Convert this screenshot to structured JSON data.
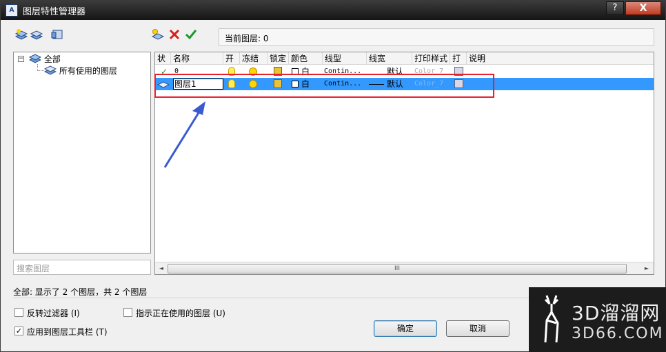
{
  "window": {
    "title": "图层特性管理器",
    "icon_text": "A",
    "help_label": "?",
    "close_label": "X"
  },
  "toolbar": {
    "left_icons": [
      "new-filter-icon",
      "group-filter-icon",
      "state-manager-icon"
    ],
    "right_icons": [
      "new-layer-icon",
      "delete-layer-icon",
      "set-current-icon"
    ]
  },
  "current_layer": {
    "label": "当前图层: 0"
  },
  "tree": {
    "root_label": "全部",
    "toggle": "−",
    "child_label": "所有使用的图层"
  },
  "search": {
    "placeholder": "搜索图层"
  },
  "table": {
    "headers": [
      "状",
      "名称",
      "开",
      "冻结",
      "锁定",
      "颜色",
      "线型",
      "线宽",
      "打印样式",
      "打",
      "说明"
    ],
    "rows": [
      {
        "status": "✓",
        "name": "0",
        "color_name": "白",
        "linetype": "Contin...",
        "lineweight": "默认",
        "plot_style": "Color_7"
      },
      {
        "status": "layer-icon",
        "name": "图层1",
        "color_name": "白",
        "linetype": "Contin...",
        "lineweight": "默认",
        "plot_style": "Color_7"
      }
    ]
  },
  "scroll": {
    "left": "◄",
    "right": "►",
    "grip": "III"
  },
  "status_bar": {
    "text": "全部: 显示了 2 个图层，共 2 个图层"
  },
  "options": {
    "invert_filter": "反转过滤器 (I)",
    "indicate_in_use": "指示正在使用的图层 (U)",
    "apply_to_toolbar": "应用到图层工具栏 (T)",
    "apply_checked": "✓"
  },
  "buttons": {
    "ok": "确定",
    "cancel": "取消"
  },
  "watermark": {
    "brand": "3D溜溜网",
    "domain": "3D66.COM"
  },
  "colors": {
    "selection": "#3399ff",
    "annotation": "#e8202a",
    "arrow": "#3a5bd0"
  }
}
